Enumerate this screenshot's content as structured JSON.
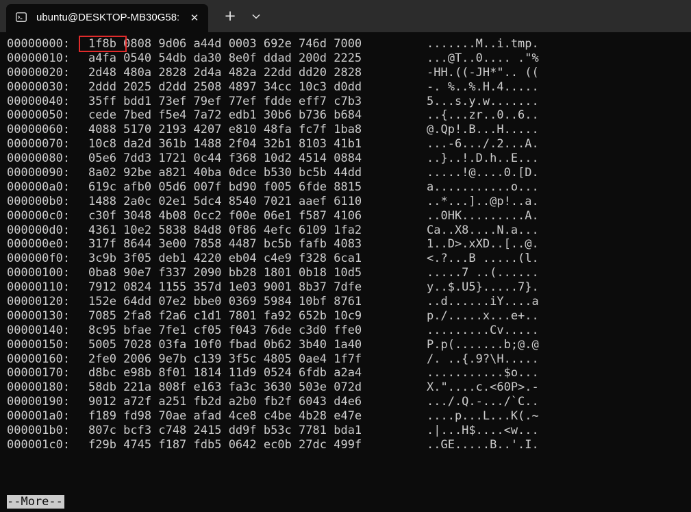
{
  "window": {
    "tab_title": "ubuntu@DESKTOP-MB30G58:",
    "tab_icon": "terminal-icon",
    "close_glyph": "✕",
    "new_tab_glyph": "+",
    "dropdown_icon": "chevron-down-icon"
  },
  "colors": {
    "background": "#0c0c0c",
    "text": "#cccccc",
    "highlight": "#e02b2b",
    "titlebar": "#2c2c2c"
  },
  "terminal": {
    "highlighted_text": "1f8b",
    "pager_prompt": "--More--",
    "rows": [
      {
        "offset": "00000000:",
        "hex": "1f8b 0808 9d06 a44d 0003 692e 746d 7000",
        "ascii": ".......M..i.tmp."
      },
      {
        "offset": "00000010:",
        "hex": "a4fa 0540 54db da30 8e0f ddad 200d 2225",
        "ascii": "...@T..0.... .\"%"
      },
      {
        "offset": "00000020:",
        "hex": "2d48 480a 2828 2d4a 482a 22dd dd20 2828",
        "ascii": "-HH.((-JH*\".. (("
      },
      {
        "offset": "00000030:",
        "hex": "2ddd 2025 d2dd 2508 4897 34cc 10c3 d0dd",
        "ascii": "-. %..%.H.4....."
      },
      {
        "offset": "00000040:",
        "hex": "35ff bdd1 73ef 79ef 77ef fdde eff7 c7b3",
        "ascii": "5...s.y.w......."
      },
      {
        "offset": "00000050:",
        "hex": "cede 7bed f5e4 7a72 edb1 30b6 b736 b684",
        "ascii": "..{...zr..0..6.."
      },
      {
        "offset": "00000060:",
        "hex": "4088 5170 2193 4207 e810 48fa fc7f 1ba8",
        "ascii": "@.Qp!.B...H....."
      },
      {
        "offset": "00000070:",
        "hex": "10c8 da2d 361b 1488 2f04 32b1 8103 41b1",
        "ascii": "...-6.../.2...A."
      },
      {
        "offset": "00000080:",
        "hex": "05e6 7dd3 1721 0c44 f368 10d2 4514 0884",
        "ascii": "..}..!.D.h..E..."
      },
      {
        "offset": "00000090:",
        "hex": "8a02 92be a821 40ba 0dce b530 bc5b 44dd",
        "ascii": ".....!@....0.[D."
      },
      {
        "offset": "000000a0:",
        "hex": "619c afb0 05d6 007f bd90 f005 6fde 8815",
        "ascii": "a...........o..."
      },
      {
        "offset": "000000b0:",
        "hex": "1488 2a0c 02e1 5dc4 8540 7021 aaef 6110",
        "ascii": "..*...]..@p!..a."
      },
      {
        "offset": "000000c0:",
        "hex": "c30f 3048 4b08 0cc2 f00e 06e1 f587 4106",
        "ascii": "..0HK.........A."
      },
      {
        "offset": "000000d0:",
        "hex": "4361 10e2 5838 84d8 0f86 4efc 6109 1fa2",
        "ascii": "Ca..X8....N.a..."
      },
      {
        "offset": "000000e0:",
        "hex": "317f 8644 3e00 7858 4487 bc5b fafb 4083",
        "ascii": "1..D>.xXD..[..@."
      },
      {
        "offset": "000000f0:",
        "hex": "3c9b 3f05 deb1 4220 eb04 c4e9 f328 6ca1",
        "ascii": "<.?...B .....(l."
      },
      {
        "offset": "00000100:",
        "hex": "0ba8 90e7 f337 2090 bb28 1801 0b18 10d5",
        "ascii": ".....7 ..(......"
      },
      {
        "offset": "00000110:",
        "hex": "7912 0824 1155 357d 1e03 9001 8b37 7dfe",
        "ascii": "y..$.U5}.....7}."
      },
      {
        "offset": "00000120:",
        "hex": "152e 64dd 07e2 bbe0 0369 5984 10bf 8761",
        "ascii": "..d......iY....a"
      },
      {
        "offset": "00000130:",
        "hex": "7085 2fa8 f2a6 c1d1 7801 fa92 652b 10c9",
        "ascii": "p./.....x...e+.."
      },
      {
        "offset": "00000140:",
        "hex": "8c95 bfae 7fe1 cf05 f043 76de c3d0 ffe0",
        "ascii": ".........Cv....."
      },
      {
        "offset": "00000150:",
        "hex": "5005 7028 03fa 10f0 fbad 0b62 3b40 1a40",
        "ascii": "P.p(.......b;@.@"
      },
      {
        "offset": "00000160:",
        "hex": "2fe0 2006 9e7b c139 3f5c 4805 0ae4 1f7f",
        "ascii": "/. ..{.9?\\H....."
      },
      {
        "offset": "00000170:",
        "hex": "d8bc e98b 8f01 1814 11d9 0524 6fdb a2a4",
        "ascii": "...........$o..."
      },
      {
        "offset": "00000180:",
        "hex": "58db 221a 808f e163 fa3c 3630 503e 072d",
        "ascii": "X.\"....c.<60P>.-"
      },
      {
        "offset": "00000190:",
        "hex": "9012 a72f a251 fb2d a2b0 fb2f 6043 d4e6",
        "ascii": ".../.Q.-.../`C.."
      },
      {
        "offset": "000001a0:",
        "hex": "f189 fd98 70ae afad 4ce8 c4be 4b28 e47e",
        "ascii": "....p...L...K(.~"
      },
      {
        "offset": "000001b0:",
        "hex": "807c bcf3 c748 2415 dd9f b53c 7781 bda1",
        "ascii": ".|...H$....<w..."
      },
      {
        "offset": "000001c0:",
        "hex": "f29b 4745 f187 fdb5 0642 ec0b 27dc 499f",
        "ascii": "..GE.....B..'.I."
      }
    ]
  }
}
